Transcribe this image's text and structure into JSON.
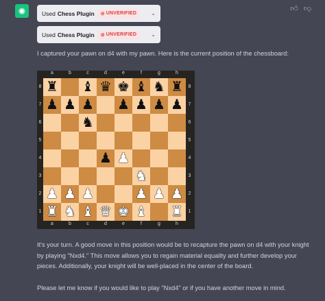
{
  "plugin_calls": [
    {
      "used_label": "Used",
      "plugin_name": "Chess Plugin",
      "badge": "UNVERIFIED"
    },
    {
      "used_label": "Used",
      "plugin_name": "Chess Plugin",
      "badge": "UNVERIFIED"
    }
  ],
  "message_intro": "I captured your pawn on d4 with my pawn. Here is the current position of the chessboard:",
  "board": {
    "files": [
      "a",
      "b",
      "c",
      "d",
      "e",
      "f",
      "g",
      "h"
    ],
    "ranks": [
      "8",
      "7",
      "6",
      "5",
      "4",
      "3",
      "2",
      "1"
    ],
    "rows": [
      [
        "bR",
        "",
        "bB",
        "bQ",
        "bK",
        "bB",
        "bN",
        "bR"
      ],
      [
        "bP",
        "bP",
        "bP",
        "",
        "bP",
        "bP",
        "bP",
        "bP"
      ],
      [
        "",
        "",
        "bN",
        "",
        "",
        "",
        "",
        ""
      ],
      [
        "",
        "",
        "",
        "",
        "",
        "",
        "",
        ""
      ],
      [
        "",
        "",
        "",
        "bP",
        "wP",
        "",
        "",
        ""
      ],
      [
        "",
        "",
        "",
        "",
        "",
        "wN",
        "",
        ""
      ],
      [
        "wP",
        "wP",
        "wP",
        "",
        "",
        "wP",
        "wP",
        "wP"
      ],
      [
        "wR",
        "wN",
        "wB",
        "wQ",
        "wK",
        "wB",
        "",
        "wR"
      ]
    ]
  },
  "message_followup": "It's your turn. A good move in this position would be to recapture the pawn on d4 with your knight by playing \"Nxd4.\" This move allows you to regain material equality and further develop your pieces. Additionally, your knight will be well-placed in the center of the board.",
  "message_closing": "Please let me know if you would like to play \"Nxd4\" or if you have another move in mind.",
  "icons": {
    "avatar": "openai-logo-icon",
    "thumbs_up": "thumbs-up-icon",
    "thumbs_down": "thumbs-down-icon",
    "chevron": "chevron-down-icon",
    "badge": "unverified-icon"
  },
  "colors": {
    "background": "#444654",
    "light_square": "#fbd2a4",
    "dark_square": "#ce8b43",
    "badge_text": "#d14343",
    "avatar": "#19c37d"
  }
}
